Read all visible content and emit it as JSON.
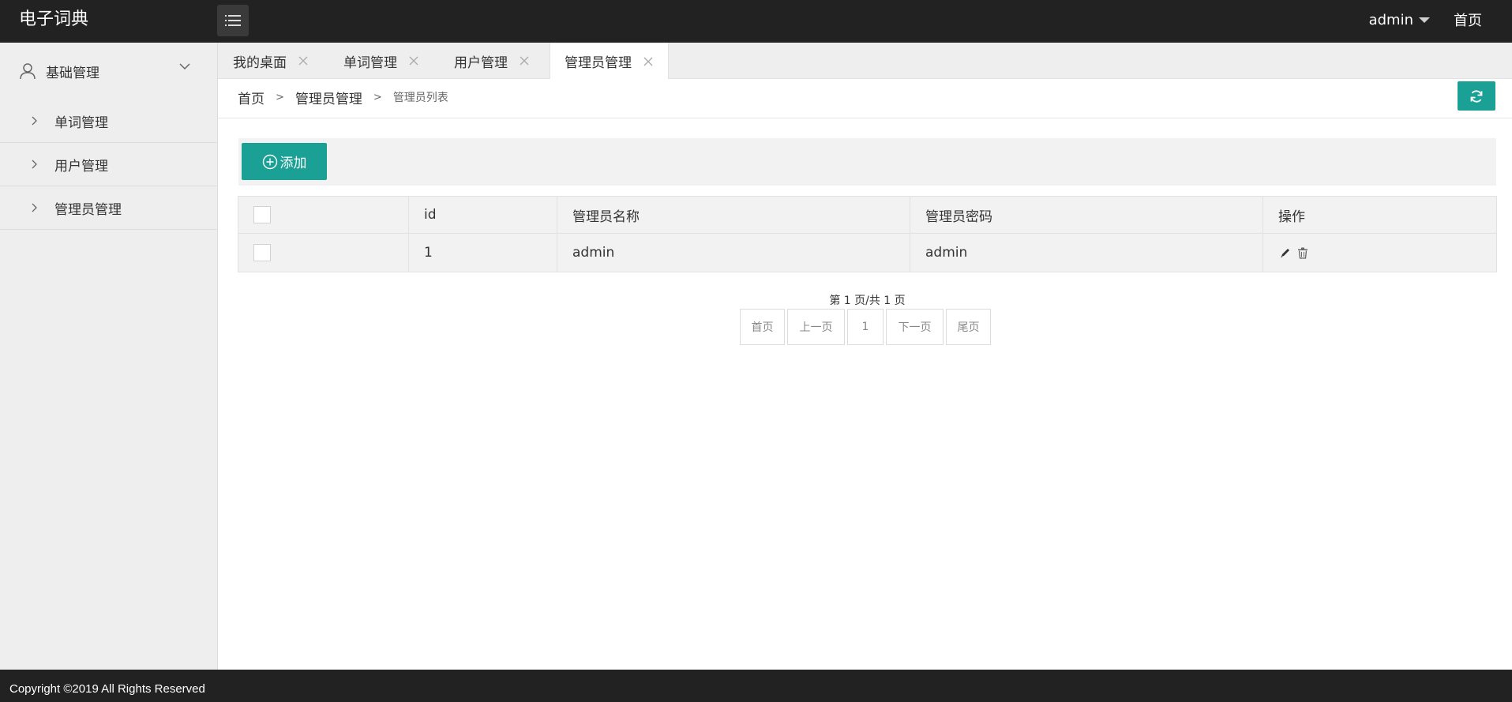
{
  "app": {
    "title": "电子词典"
  },
  "header": {
    "user": "admin",
    "home": "首页"
  },
  "sidebar": {
    "group_label": "基础管理",
    "items": [
      {
        "label": "单词管理"
      },
      {
        "label": "用户管理"
      },
      {
        "label": "管理员管理"
      }
    ]
  },
  "tabs": [
    {
      "label": "我的桌面"
    },
    {
      "label": "单词管理"
    },
    {
      "label": "用户管理"
    },
    {
      "label": "管理员管理",
      "active": true
    }
  ],
  "breadcrumb": {
    "level1": "首页",
    "level2": "管理员管理",
    "level3": "管理员列表",
    "separator": ">"
  },
  "toolbar": {
    "add_label": "添加"
  },
  "table": {
    "headers": {
      "id": "id",
      "name": "管理员名称",
      "password": "管理员密码",
      "ops": "操作"
    },
    "rows": [
      {
        "id": "1",
        "name": "admin",
        "password": "admin"
      }
    ]
  },
  "pagination": {
    "info": "第 1 页/共 1 页",
    "first": "首页",
    "prev": "上一页",
    "current": "1",
    "next": "下一页",
    "last": "尾页"
  },
  "footer": {
    "copyright": "Copyright ©2019 All Rights Reserved"
  },
  "colors": {
    "header_bg": "#222222",
    "accent": "#1aa094",
    "sidebar_bg": "#eeeeee"
  },
  "icons": [
    "menu-icon",
    "user-icon",
    "chevron-down-icon",
    "chevron-right-icon",
    "close-icon",
    "refresh-icon",
    "plus-circle-icon",
    "edit-icon",
    "trash-icon"
  ]
}
